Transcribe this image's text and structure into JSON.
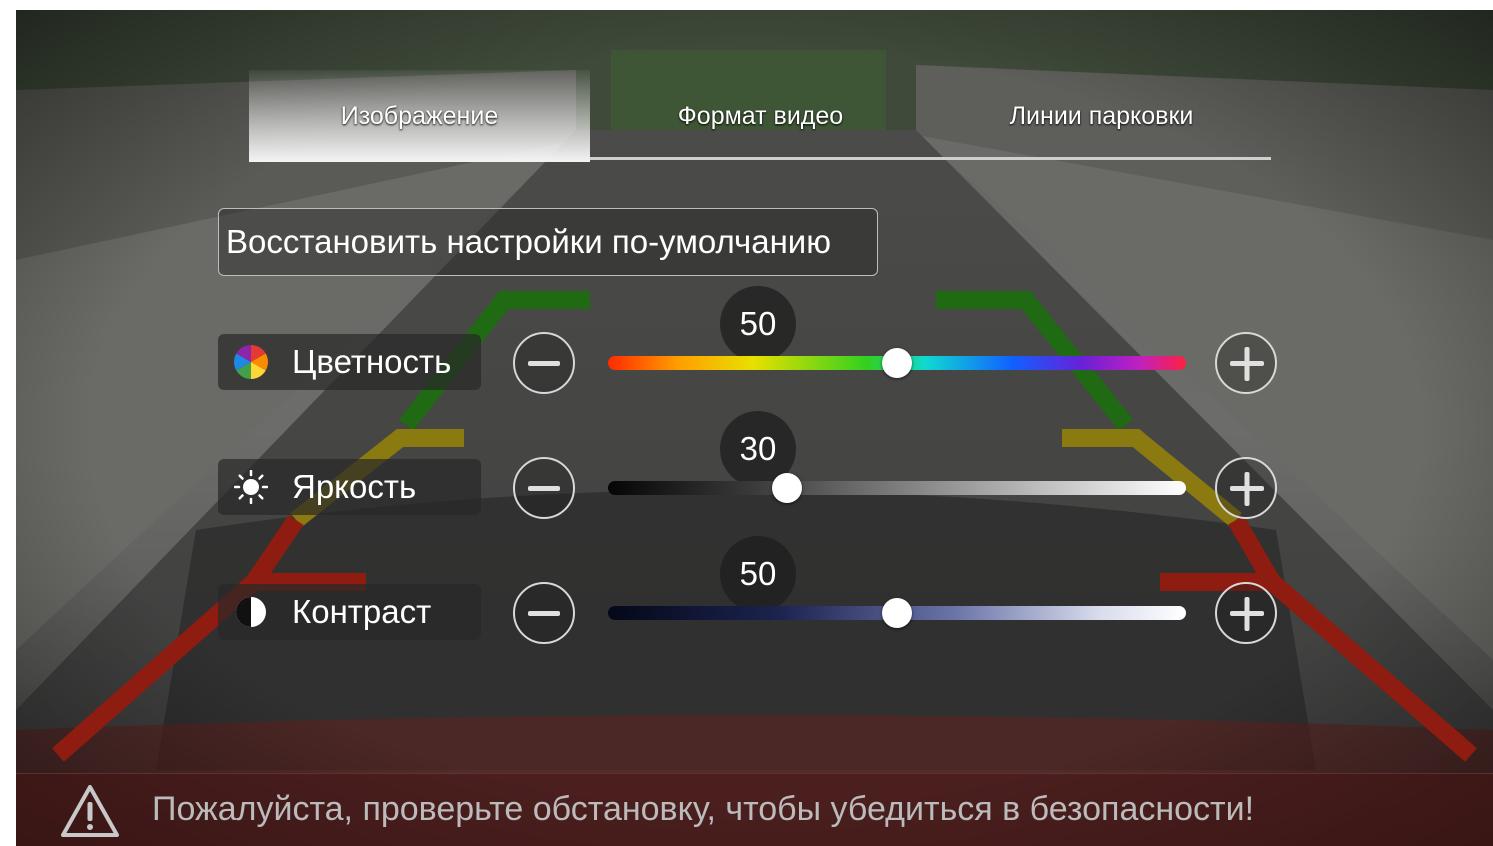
{
  "tabs": [
    {
      "label": "Изображение",
      "active": true
    },
    {
      "label": "Формат видео",
      "active": false
    },
    {
      "label": "Линии парковки",
      "active": false
    }
  ],
  "reset_button": "Восстановить настройки по-умолчанию",
  "settings": [
    {
      "label": "Цветность",
      "icon": "color-wheel-icon",
      "value": "50",
      "fraction": 0.5
    },
    {
      "label": "Яркость",
      "icon": "sun-icon",
      "value": "30",
      "fraction": 0.31
    },
    {
      "label": "Контраст",
      "icon": "contrast-icon",
      "value": "50",
      "fraction": 0.5
    }
  ],
  "warning": {
    "text": "Пожалуйста, проверьте обстановку, чтобы убедиться в безопасности!",
    "icon": "warning-triangle-icon"
  },
  "colors": {
    "guide_green": "#1f6a12",
    "guide_yellow": "#8a7a10",
    "guide_red": "#8e1c10",
    "tab_line": "#cfcfcf"
  }
}
